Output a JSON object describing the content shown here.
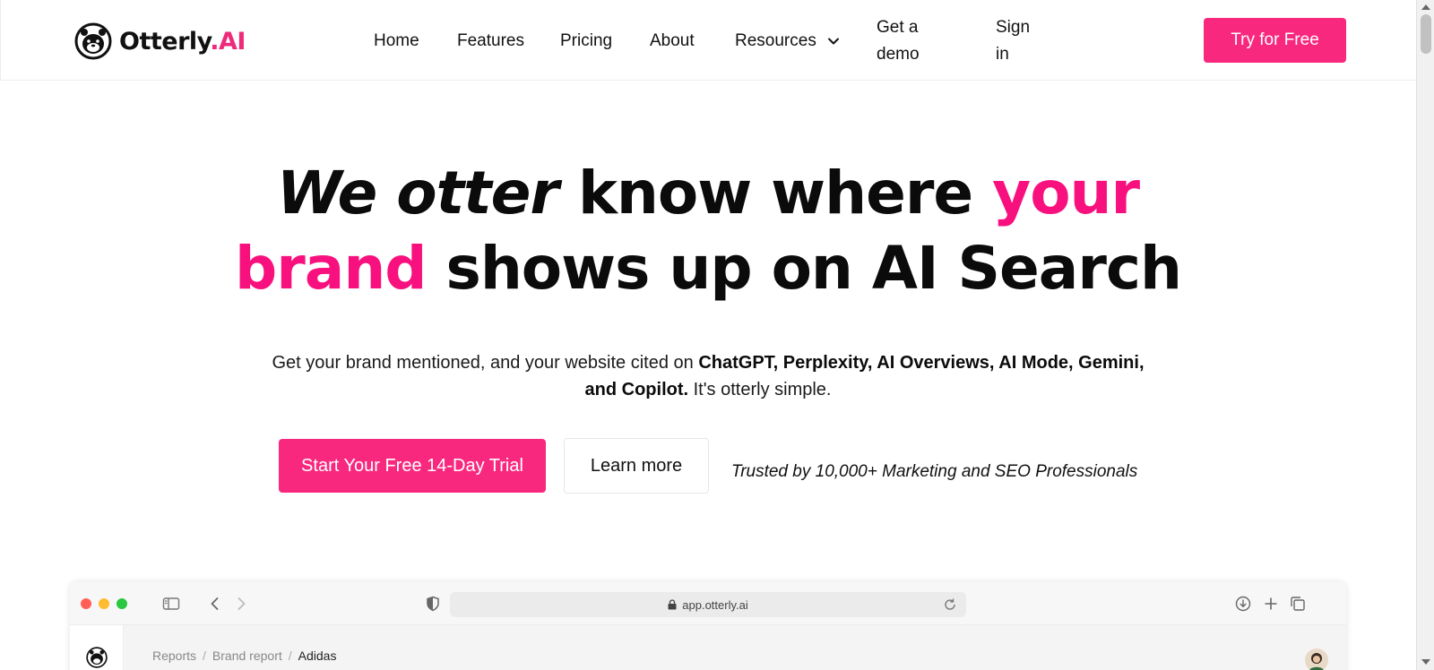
{
  "brand": {
    "name": "Otterly",
    "suffix": ".AI",
    "accent": "#f8287f"
  },
  "nav": {
    "home": "Home",
    "features": "Features",
    "pricing": "Pricing",
    "about": "About",
    "resources": "Resources",
    "demo_line1": "Get a",
    "demo_line2": "demo",
    "signin_line1": "Sign",
    "signin_line2": "in",
    "cta": "Try for Free"
  },
  "hero": {
    "title_italic": "We otter",
    "title_part2": "know where",
    "title_pink1": "your",
    "title_pink2": "brand",
    "title_part3": "shows up on AI Search",
    "subtitle_pre": "Get your brand mentioned, and your website cited on",
    "subtitle_bold": "ChatGPT, Perplexity, AI Overviews, AI Mode, Gemini, and Copilot.",
    "subtitle_post": "It's otterly simple.",
    "primary_cta": "Start Your Free 14-Day Trial",
    "secondary_cta": "Learn more",
    "trusted": "Trusted by 10,000+ Marketing and SEO Professionals"
  },
  "mockup": {
    "url": "app.otterly.ai",
    "breadcrumb": [
      "Reports",
      "Brand report",
      "Adidas"
    ],
    "icons": [
      "sidebar-toggle-icon",
      "back-icon",
      "forward-icon",
      "shield-icon",
      "lock-icon",
      "reload-icon",
      "download-icon",
      "plus-icon",
      "tabs-icon"
    ]
  }
}
